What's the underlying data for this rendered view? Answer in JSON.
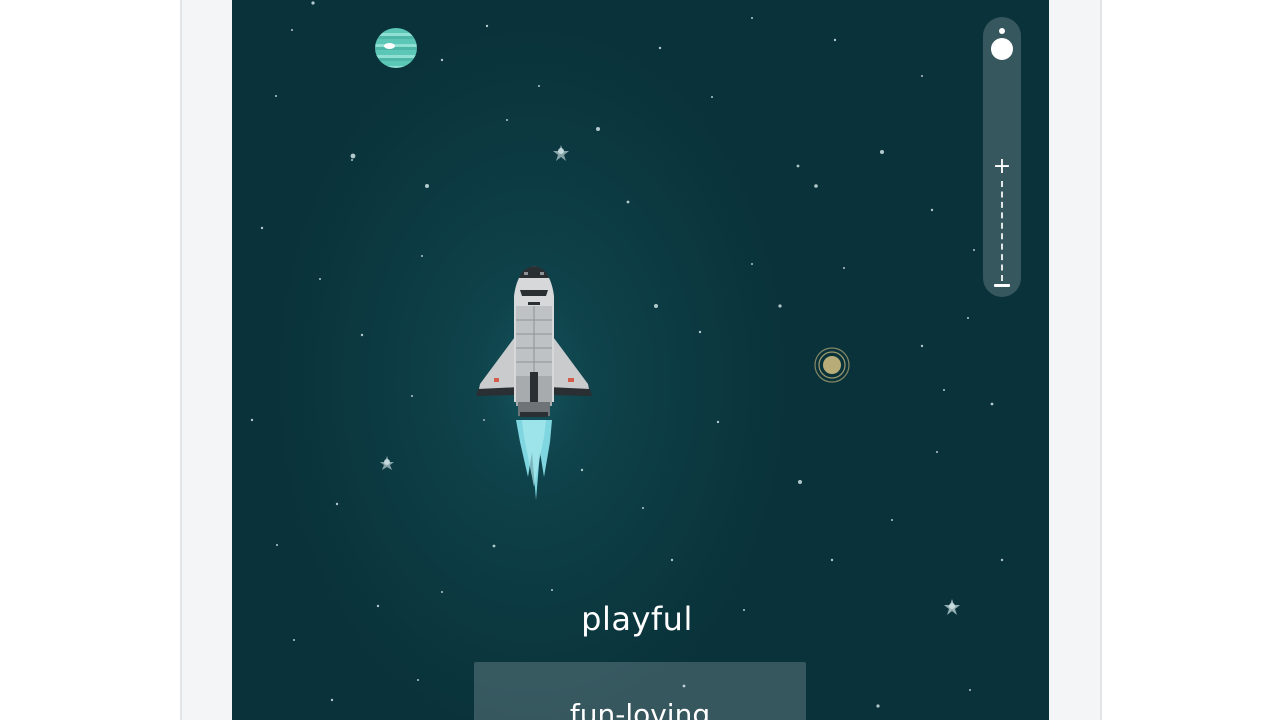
{
  "game": {
    "prompt_word": "playful",
    "answer_options": [
      "fun-loving"
    ]
  },
  "icons": {
    "zoom_top": "person-icon",
    "zoom_in": "plus-icon",
    "zoom_out": "minus-icon",
    "player": "space-shuttle-icon",
    "planet_1": "teal-planet-icon",
    "planet_2": "ringed-planet-icon"
  },
  "colors": {
    "space_background": "#0d3d45",
    "accent_teal": "#5cc7b7",
    "flame": "#7fd6e0",
    "planet_gold": "#b8ad78",
    "text": "#ffffff"
  }
}
